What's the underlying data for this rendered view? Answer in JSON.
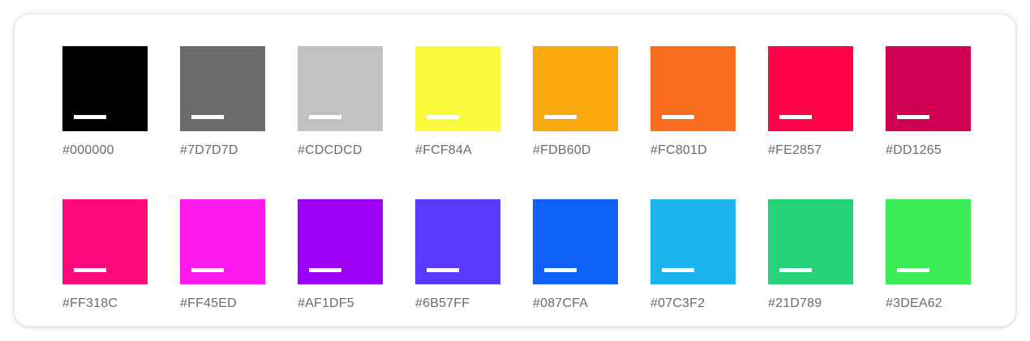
{
  "palette": {
    "rows": [
      {
        "swatches": [
          {
            "label": "#000000",
            "color": "#000000"
          },
          {
            "label": "#7D7D7D",
            "color": "#6b6b6b"
          },
          {
            "label": "#CDCDCD",
            "color": "#c2c2c2"
          },
          {
            "label": "#FCF84A",
            "color": "#fafa3c"
          },
          {
            "label": "#FDB60D",
            "color": "#fca910"
          },
          {
            "label": "#FC801D",
            "color": "#f96d1d"
          },
          {
            "label": "#FE2857",
            "color": "#ff0247"
          },
          {
            "label": "#DD1265",
            "color": "#cf0053"
          }
        ]
      },
      {
        "swatches": [
          {
            "label": "#FF318C",
            "color": "#ff0a7c"
          },
          {
            "label": "#FF45ED",
            "color": "#fe19ee"
          },
          {
            "label": "#AF1DF5",
            "color": "#9d00f6"
          },
          {
            "label": "#6B57FF",
            "color": "#5a38fe"
          },
          {
            "label": "#087CFA",
            "color": "#0e62f9"
          },
          {
            "label": "#07C3F2",
            "color": "#1bb4ef"
          },
          {
            "label": "#21D789",
            "color": "#25d47a"
          },
          {
            "label": "#3DEA62",
            "color": "#3beb55"
          }
        ]
      }
    ]
  }
}
